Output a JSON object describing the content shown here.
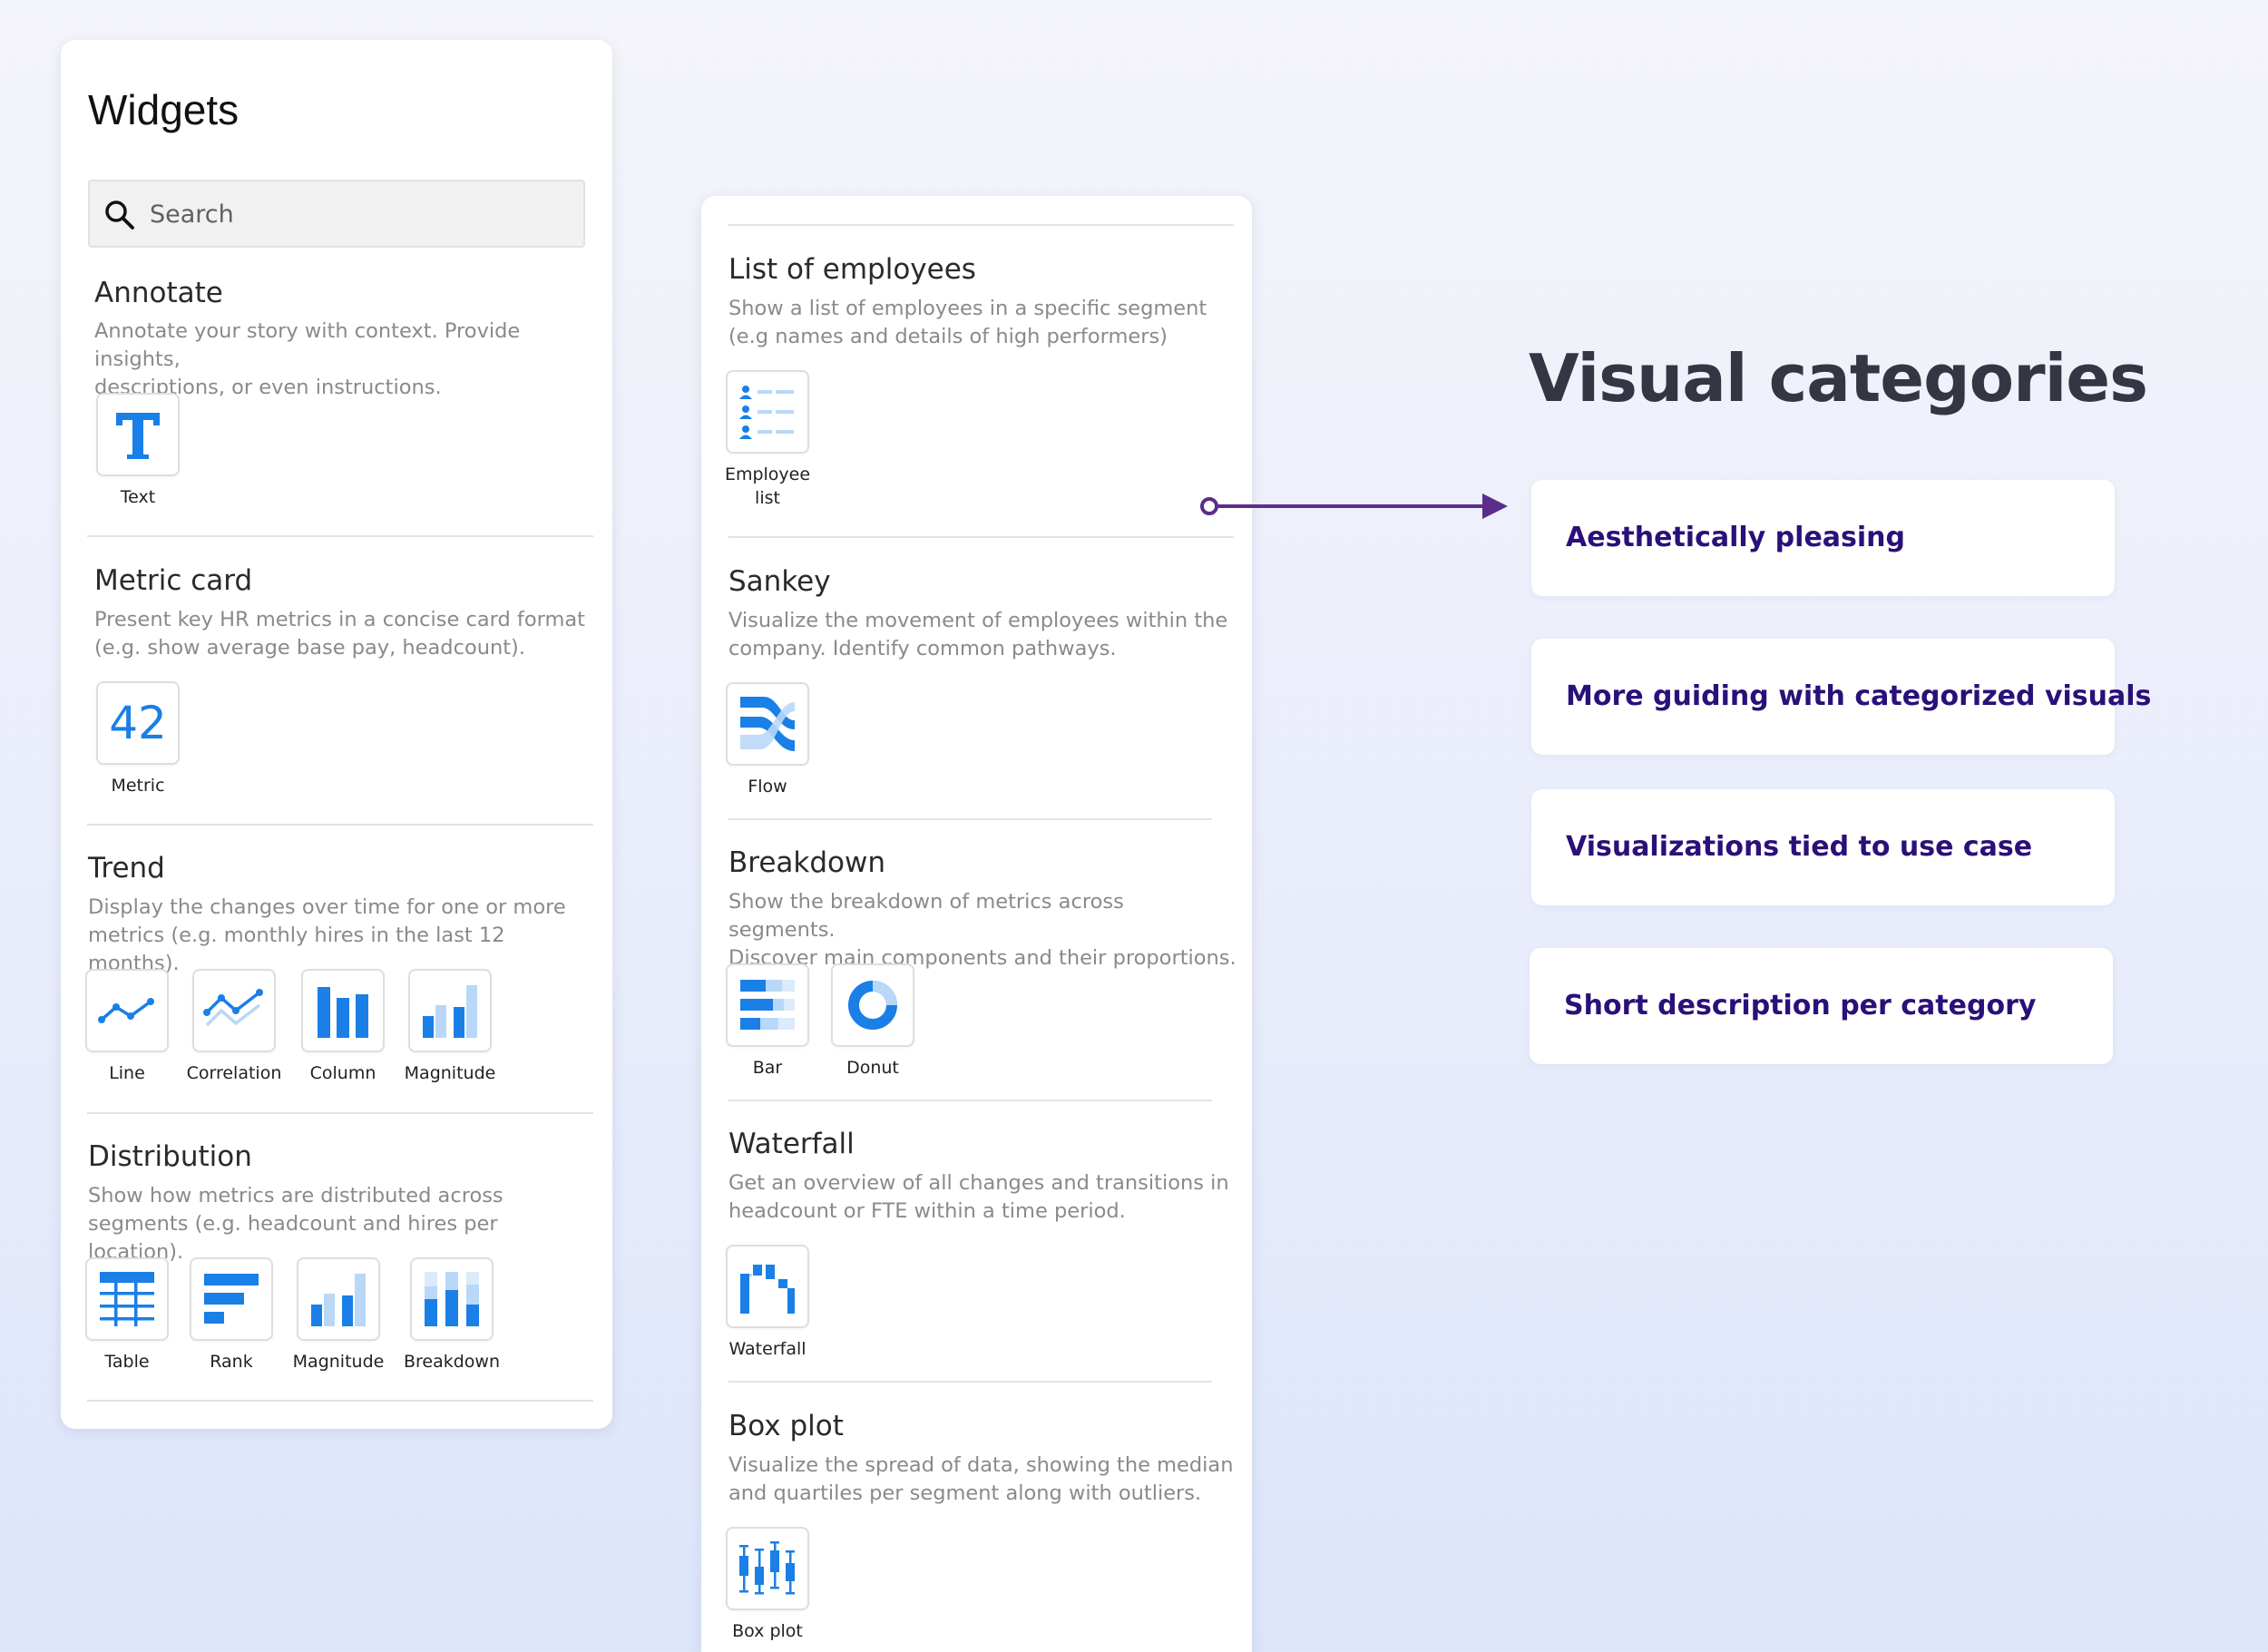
{
  "widgets_panel": {
    "title": "Widgets",
    "search_placeholder": "Search",
    "sections": [
      {
        "title": "Annotate",
        "desc_lines": [
          "Annotate your story with context. Provide insights,",
          "descriptions, or even instructions."
        ],
        "items": [
          {
            "label": "Text",
            "icon": "text-icon"
          }
        ]
      },
      {
        "title": "Metric card",
        "desc_lines": [
          "Present key HR metrics in a concise card format",
          "(e.g. show average base pay, headcount)."
        ],
        "items": [
          {
            "label": "Metric",
            "icon": "metric-number-icon",
            "icon_text": "42"
          }
        ]
      },
      {
        "title": "Trend",
        "desc_lines": [
          "Display the changes over time for one or more",
          "metrics (e.g. monthly hires in the last 12 months)."
        ],
        "items": [
          {
            "label": "Line",
            "icon": "line-chart-icon"
          },
          {
            "label": "Correlation",
            "icon": "correlation-chart-icon"
          },
          {
            "label": "Column",
            "icon": "column-chart-icon"
          },
          {
            "label": "Magnitude",
            "icon": "magnitude-chart-icon"
          }
        ]
      },
      {
        "title": "Distribution",
        "desc_lines": [
          "Show how metrics are distributed across",
          "segments (e.g. headcount and hires per location)."
        ],
        "items": [
          {
            "label": "Table",
            "icon": "table-icon"
          },
          {
            "label": "Rank",
            "icon": "rank-chart-icon"
          },
          {
            "label": "Magnitude",
            "icon": "magnitude-chart-icon"
          },
          {
            "label": "Breakdown",
            "icon": "stacked-breakdown-icon"
          }
        ]
      }
    ]
  },
  "categories_panel": {
    "sections": [
      {
        "title": "List of employees",
        "desc_lines": [
          "Show a list of employees in a specific segment",
          "(e.g names and details of high performers)"
        ],
        "items": [
          {
            "label_lines": [
              "Employee",
              "list"
            ],
            "icon": "employee-list-icon"
          }
        ]
      },
      {
        "title": "Sankey",
        "desc_lines": [
          "Visualize the movement of employees within the",
          "company. Identify common pathways."
        ],
        "items": [
          {
            "label_lines": [
              "Flow"
            ],
            "icon": "sankey-flow-icon"
          }
        ]
      },
      {
        "title": "Breakdown",
        "desc_lines": [
          "Show the breakdown of metrics across segments.",
          "Discover main components and their proportions."
        ],
        "items": [
          {
            "label_lines": [
              "Bar"
            ],
            "icon": "stacked-bar-icon"
          },
          {
            "label_lines": [
              "Donut"
            ],
            "icon": "donut-chart-icon"
          }
        ]
      },
      {
        "title": "Waterfall",
        "desc_lines": [
          "Get an overview of all changes and transitions in",
          "headcount or FTE within a time period."
        ],
        "items": [
          {
            "label_lines": [
              "Waterfall"
            ],
            "icon": "waterfall-chart-icon"
          }
        ]
      },
      {
        "title": "Box plot",
        "desc_lines": [
          "Visualize the spread of data, showing the median",
          "and quartiles per segment along with outliers."
        ],
        "items": [
          {
            "label_lines": [
              "Box plot"
            ],
            "icon": "box-plot-icon"
          }
        ]
      }
    ]
  },
  "annotation": {
    "title": "Visual categories",
    "points": [
      "Aesthetically pleasing",
      "More guiding with categorized visuals",
      "Visualizations tied to use case",
      "Short description per category"
    ]
  },
  "colors": {
    "accent_blue": "#1a7fe6",
    "light_blue": "#b9d8f7",
    "annotation_text": "#2a1079",
    "arrow": "#5b2d8c"
  }
}
